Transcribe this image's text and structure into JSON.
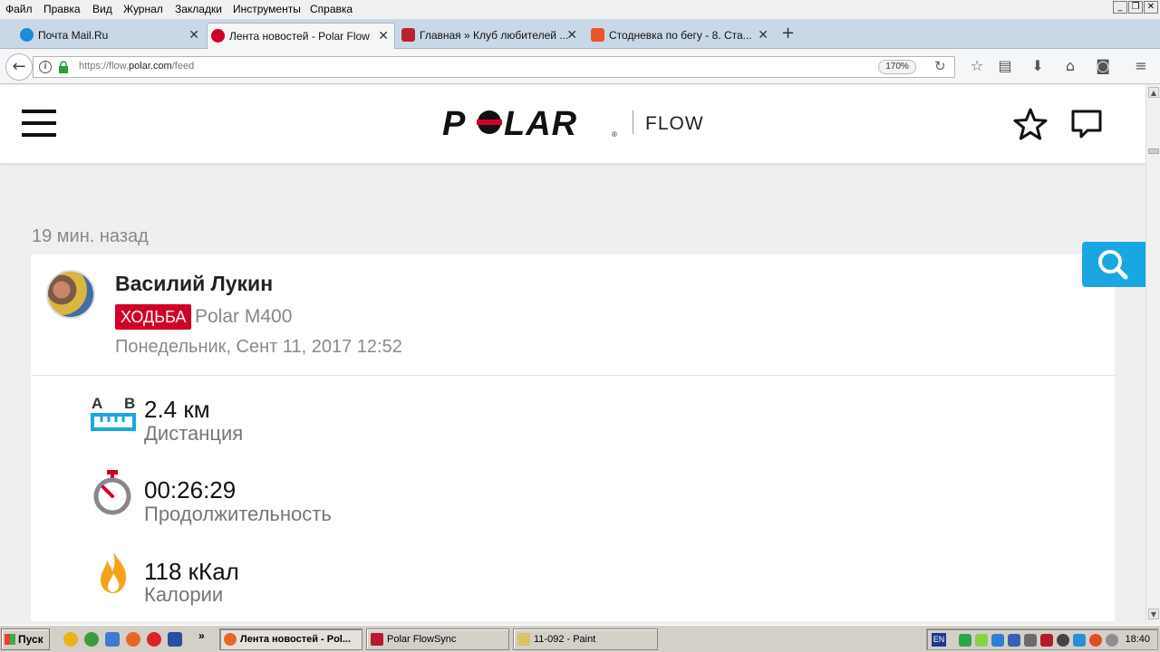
{
  "menubar": {
    "items": [
      "Файл",
      "Правка",
      "Вид",
      "Журнал",
      "Закладки",
      "Инструменты",
      "Справка"
    ],
    "window_buttons": [
      "_",
      "❐",
      "✕"
    ]
  },
  "tabs": [
    {
      "title": "Почта Mail.Ru",
      "active": false
    },
    {
      "title": "Лента новостей - Polar Flow",
      "active": true
    },
    {
      "title": "Главная » Клуб любителей ...",
      "active": false
    },
    {
      "title": "Стодневка по бегу - 8. Ста...",
      "active": false
    }
  ],
  "tab_close": "✕",
  "new_tab": "+",
  "navbar": {
    "url_prefix": "https://flow.",
    "url_domain": "polar.com",
    "url_path": "/feed",
    "zoom": "170%"
  },
  "site": {
    "logo_text": "POLAR",
    "product": "FLOW"
  },
  "feed": {
    "time_ago": "19 мин. назад",
    "user_name": "Василий Лукин",
    "sport": "ХОДЬБА",
    "device": "Polar M400",
    "date": "Понедельник, Сент 11, 2017 12:52",
    "stats": [
      {
        "value": "2.4 км",
        "label": "Дистанция",
        "icon": "distance-icon"
      },
      {
        "value": "00:26:29",
        "label": "Продолжительность",
        "icon": "stopwatch-icon"
      },
      {
        "value": "118 кКал",
        "label": "Калории",
        "icon": "flame-icon"
      }
    ],
    "distance_icon_labels": {
      "a": "A",
      "b": "B"
    }
  },
  "taskbar": {
    "start": "Пуск",
    "overflow": "»",
    "windows": [
      {
        "title": "Лента новостей - Pol...",
        "active": true
      },
      {
        "title": "Polar FlowSync",
        "active": false
      },
      {
        "title": "11-092 - Paint",
        "active": false
      }
    ],
    "lang": "EN",
    "clock": "18:40"
  },
  "colors": {
    "brand_red": "#d10027",
    "accent_blue": "#1aa7e1",
    "flame_orange": "#f7a21b"
  }
}
